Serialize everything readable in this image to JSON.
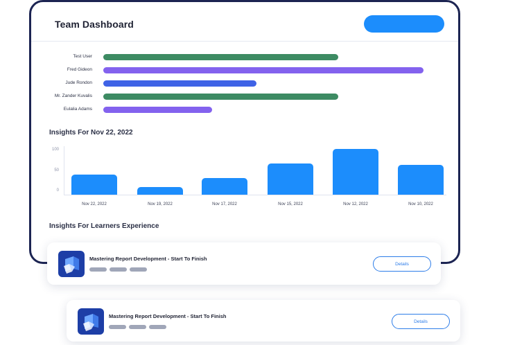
{
  "dashboard": {
    "title": "Team Dashboard",
    "header_button_label": ""
  },
  "users": [
    {
      "name": "Test User",
      "progress": 0.69,
      "color": "#3d8b63"
    },
    {
      "name": "Fred Gideon",
      "progress": 0.94,
      "color": "#8362ee"
    },
    {
      "name": "Jude Rondon",
      "progress": 0.45,
      "color": "#3f63e6"
    },
    {
      "name": "Mr. Zander Kuvalis",
      "progress": 0.69,
      "color": "#3d8b63"
    },
    {
      "name": "Eulalia Adams",
      "progress": 0.32,
      "color": "#8362ee"
    }
  ],
  "insights": {
    "title": "Insights For Nov 22, 2022"
  },
  "chart_data": {
    "type": "bar",
    "title": "Insights For Nov 22, 2022",
    "categories": [
      "Nov 22, 2022",
      "Nov 19, 2022",
      "Nov 17, 2022",
      "Nov 15, 2022",
      "Nov 12, 2022",
      "Nov 10, 2022"
    ],
    "values": [
      45,
      18,
      38,
      70,
      103,
      67
    ],
    "y_ticks": [
      "100",
      "50",
      "0"
    ],
    "ylim": [
      0,
      110
    ],
    "color": "#1c8dfc",
    "grid": false
  },
  "learners": {
    "title": "Insights For Learners Experience"
  },
  "cards": [
    {
      "title": "Mastering Report Development - Start To Finish",
      "button": "Details"
    },
    {
      "title": "Mastering Report Development - Start To Finish",
      "button": "Details"
    }
  ]
}
